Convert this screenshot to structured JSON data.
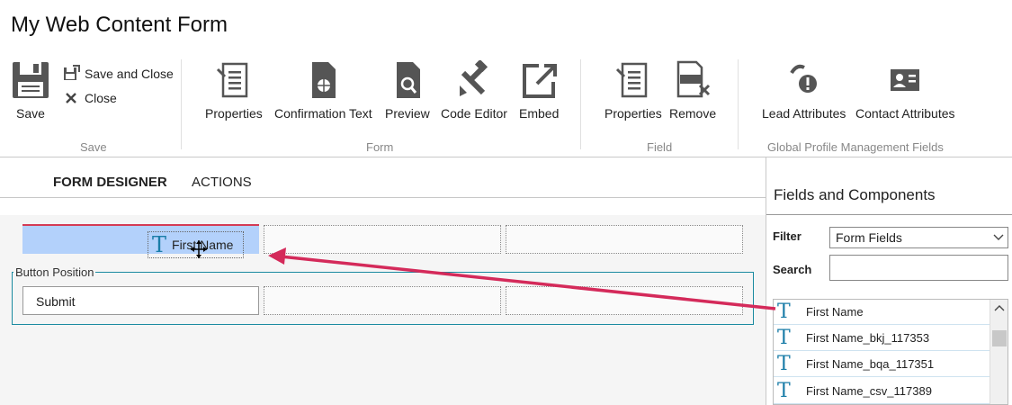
{
  "title": "My Web Content Form",
  "ribbon": {
    "save": "Save",
    "save_and_close": "Save and Close",
    "close": "Close",
    "form_properties": "Properties",
    "confirmation_text": "Confirmation Text",
    "preview": "Preview",
    "code_editor": "Code Editor",
    "embed": "Embed",
    "field_properties": "Properties",
    "remove": "Remove",
    "lead_attributes": "Lead Attributes",
    "contact_attributes": "Contact Attributes",
    "groups": {
      "save": "Save",
      "form": "Form",
      "field": "Field",
      "gpm": "Global Profile Management Fields"
    }
  },
  "tabs": [
    "FORM DESIGNER",
    "ACTIONS"
  ],
  "designer": {
    "drag_label": "First Name",
    "fieldset_legend": "Button Position",
    "submit_label": "Submit"
  },
  "panel": {
    "title": "Fields and Components",
    "filter_label": "Filter",
    "filter_value": "Form Fields",
    "search_label": "Search",
    "search_value": "",
    "items": [
      {
        "label": "First Name"
      },
      {
        "label": "First Name_bkj_117353"
      },
      {
        "label": "First Name_bqa_117351"
      },
      {
        "label": "First Name_csv_117389"
      }
    ]
  },
  "colors": {
    "accent": "#1a7da8",
    "arrow": "#d42a5a",
    "selection": "#b3d1fb",
    "fieldset_border": "#1a8aa0"
  }
}
